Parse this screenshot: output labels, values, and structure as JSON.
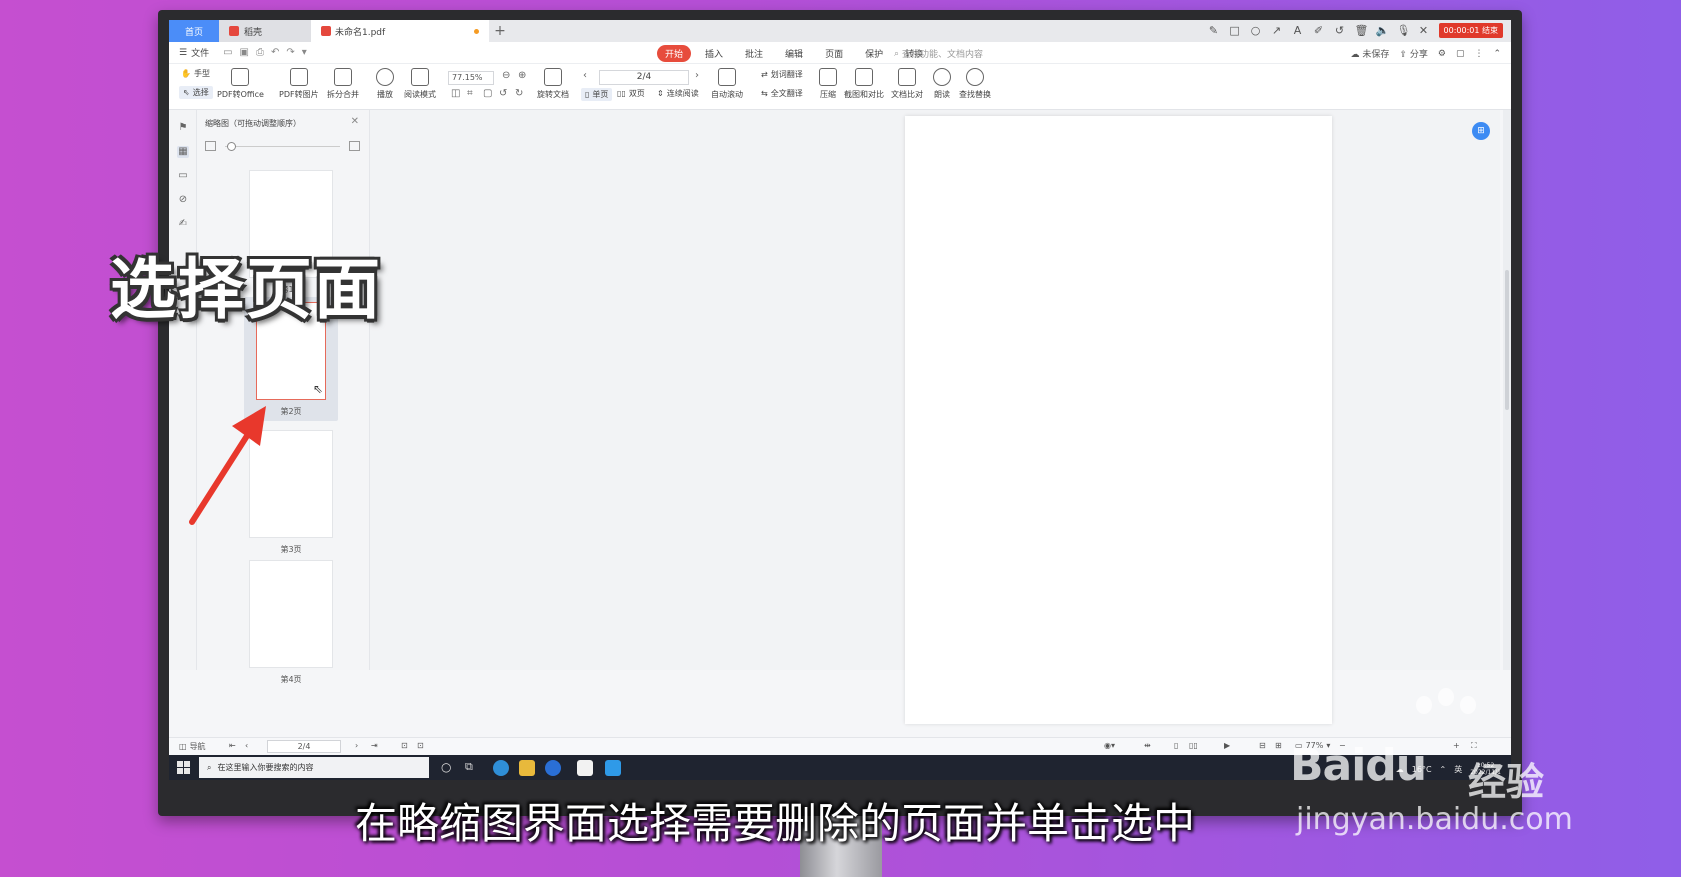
{
  "titlebar": {
    "home_tab": "首页",
    "shell_tab": "稻壳",
    "doc_tab": "未命名1.pdf",
    "add_tab": "+",
    "recording": "00:00:01 结束"
  },
  "menu": {
    "file": "文件",
    "tabs": [
      {
        "label": "开始",
        "active": true
      },
      {
        "label": "插入",
        "active": false
      },
      {
        "label": "批注",
        "active": false
      },
      {
        "label": "编辑",
        "active": false
      },
      {
        "label": "页面",
        "active": false
      },
      {
        "label": "保护",
        "active": false
      },
      {
        "label": "转换",
        "active": false
      }
    ],
    "search_placeholder": "查找功能、文档内容",
    "unsaved": "未保存",
    "share": "分享"
  },
  "ribbon": {
    "hand": "手型",
    "select": "选择",
    "pdf_to_office": "PDF转Office",
    "pdf_to_image": "PDF转图片",
    "split_merge": "拆分合并",
    "play": "播放",
    "read_mode": "阅读模式",
    "zoom": "77.15%",
    "rotate_doc": "旋转文档",
    "page_field": "2/4",
    "single_page": "单页",
    "double_page": "双页",
    "continuous": "连续阅读",
    "auto_scroll": "自动滚动",
    "word_translate": "划词翻译",
    "full_translate": "全文翻译",
    "compress": "压缩",
    "screenshot_compare": "截图和对比",
    "doc_compare": "文档比对",
    "read_aloud": "朗读",
    "find_replace": "查找替换"
  },
  "thumbnails": {
    "title": "缩略图（可拖动调整顺序）",
    "pages": [
      {
        "label": "第1页",
        "selected": false
      },
      {
        "label": "第2页",
        "selected": true
      },
      {
        "label": "第3页",
        "selected": false
      },
      {
        "label": "第4页",
        "selected": false
      }
    ]
  },
  "statusbar": {
    "nav": "导航",
    "page": "2/4",
    "zoom": "77%"
  },
  "taskbar": {
    "search_placeholder": "在这里输入你要搜索的内容",
    "temperature": "16°C",
    "ime": "英",
    "time": "10:52",
    "date": "2022/11/1"
  },
  "overlay": {
    "title": "选择页面",
    "caption": "在略缩图界面选择需要删除的页面并单击选中"
  },
  "watermark": {
    "logo": "Baidu",
    "logo_suffix": "经验",
    "url": "jingyan.baidu.com"
  },
  "colors": {
    "accent": "#4b8df8",
    "active_tab": "#e74c3c",
    "selection_border": "#e66a5a",
    "arrow": "#e8382c"
  }
}
